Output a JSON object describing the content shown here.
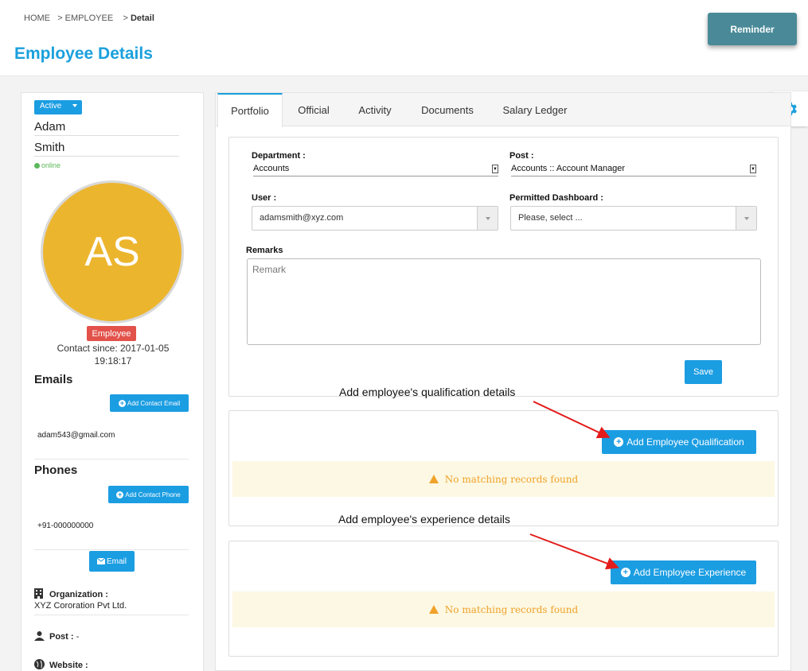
{
  "breadcrumb": {
    "home": "HOME",
    "employee": "EMPLOYEE",
    "detail": "Detail",
    "sep": ">"
  },
  "page_title": "Employee Details",
  "reminder_label": "Reminder",
  "profile": {
    "status": "Active",
    "first_name": "Adam",
    "last_name": "Smith",
    "online": "online",
    "initials": "AS",
    "role": "Employee",
    "contact_since": "Contact since: 2017-01-05 19:18:17"
  },
  "emails": {
    "heading": "Emails",
    "add_label": "Add Contact Email",
    "value": "adam543@gmail.com"
  },
  "phones": {
    "heading": "Phones",
    "add_label": "Add Contact Phone",
    "value": "+91-000000000"
  },
  "email_button": "Email",
  "organization": {
    "label": "Organization :",
    "value": "XYZ Cororation Pvt Ltd."
  },
  "post": {
    "label": "Post :",
    "value": "-"
  },
  "website": {
    "label": "Website :"
  },
  "tabs": [
    "Portfolio",
    "Official",
    "Activity",
    "Documents",
    "Salary Ledger"
  ],
  "form": {
    "department_label": "Department :",
    "department_value": "Accounts",
    "post_label": "Post :",
    "post_value": "Accounts :: Account Manager",
    "user_label": "User :",
    "user_value": "adamsmith@xyz.com",
    "dashboard_label": "Permitted Dashboard :",
    "dashboard_value": "Please, select ...",
    "remarks_label": "Remarks",
    "remarks_placeholder": "Remark",
    "save_label": "Save"
  },
  "qualification": {
    "annotation": "Add employee's qualification details",
    "button": "Add Employee Qualification",
    "empty": "No matching records found"
  },
  "experience": {
    "annotation": "Add employee's experience details",
    "button": "Add Employee Experience",
    "empty": "No matching records found"
  },
  "colors": {
    "accent": "#1ba0dc",
    "button": "#1b9de2",
    "avatar": "#ecb52e",
    "badge": "#e2524b",
    "warning": "#f0a22a",
    "arrow": "#e31b1b"
  },
  "icons": {
    "gear": "gear-icon",
    "building": "building-icon",
    "user": "user-icon",
    "globe": "globe-icon",
    "envelope": "envelope-icon",
    "plus": "plus-circle-icon",
    "warning": "warning-icon"
  }
}
